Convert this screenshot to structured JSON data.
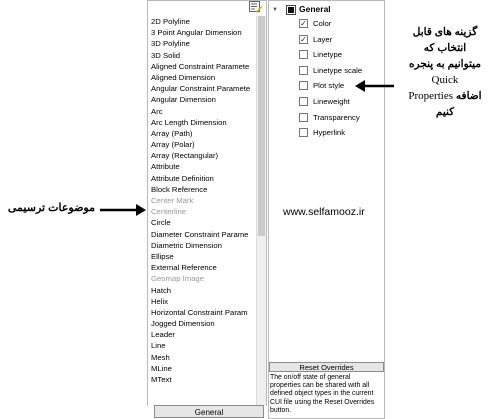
{
  "object_list": [
    {
      "label": "2D Polyline",
      "dim": false
    },
    {
      "label": "3 Point Angular Dimension",
      "dim": false
    },
    {
      "label": "3D Polyline",
      "dim": false
    },
    {
      "label": "3D Solid",
      "dim": false
    },
    {
      "label": "Aligned Constraint Paramete",
      "dim": false
    },
    {
      "label": "Aligned Dimension",
      "dim": false
    },
    {
      "label": "Angular Constraint Paramete",
      "dim": false
    },
    {
      "label": "Angular Dimension",
      "dim": false
    },
    {
      "label": "Arc",
      "dim": false
    },
    {
      "label": "Arc Length Dimension",
      "dim": false
    },
    {
      "label": "Array (Path)",
      "dim": false
    },
    {
      "label": "Array (Polar)",
      "dim": false
    },
    {
      "label": "Array (Rectangular)",
      "dim": false
    },
    {
      "label": "Attribute",
      "dim": false
    },
    {
      "label": "Attribute Definition",
      "dim": false
    },
    {
      "label": "Block Reference",
      "dim": false
    },
    {
      "label": "Center Mark",
      "dim": true
    },
    {
      "label": "Centerline",
      "dim": true
    },
    {
      "label": "Circle",
      "dim": false
    },
    {
      "label": "Diameter Constraint Parame",
      "dim": false
    },
    {
      "label": "Diametric Dimension",
      "dim": false
    },
    {
      "label": "Ellipse",
      "dim": false
    },
    {
      "label": "External Reference",
      "dim": false
    },
    {
      "label": "Geomap Image",
      "dim": true
    },
    {
      "label": "Hatch",
      "dim": false
    },
    {
      "label": "Helix",
      "dim": false
    },
    {
      "label": "Horizontal Constraint Param",
      "dim": false
    },
    {
      "label": "Jogged Dimension",
      "dim": false
    },
    {
      "label": "Leader",
      "dim": false
    },
    {
      "label": "Line",
      "dim": false
    },
    {
      "label": "Mesh",
      "dim": false
    },
    {
      "label": "MLine",
      "dim": false
    },
    {
      "label": "MText",
      "dim": false
    }
  ],
  "tab_general": "General",
  "section": "General",
  "properties": [
    {
      "label": "Color",
      "checked": true
    },
    {
      "label": "Layer",
      "checked": true
    },
    {
      "label": "Linetype",
      "checked": false
    },
    {
      "label": "Linetype scale",
      "checked": false
    },
    {
      "label": "Plot style",
      "checked": false
    },
    {
      "label": "Lineweight",
      "checked": false
    },
    {
      "label": "Transparency",
      "checked": false
    },
    {
      "label": "Hyperlink",
      "checked": false
    }
  ],
  "reset_button": "Reset Overrides",
  "description": "The on/off state of general properties can be shared with all defined object types in the current CUI file using the Reset Overrides button.",
  "website": "www.selfamooz.ir",
  "annotation_right": {
    "line1": "گزینه های قابل",
    "line2": "انتخاب که",
    "line3": "میتوانیم به پنجره",
    "line4": "Quick",
    "line5_latin": "Properties",
    "line5_fa": "اضافه",
    "line6": "کنیم"
  },
  "annotation_left": "موضوعات ترسیمی"
}
